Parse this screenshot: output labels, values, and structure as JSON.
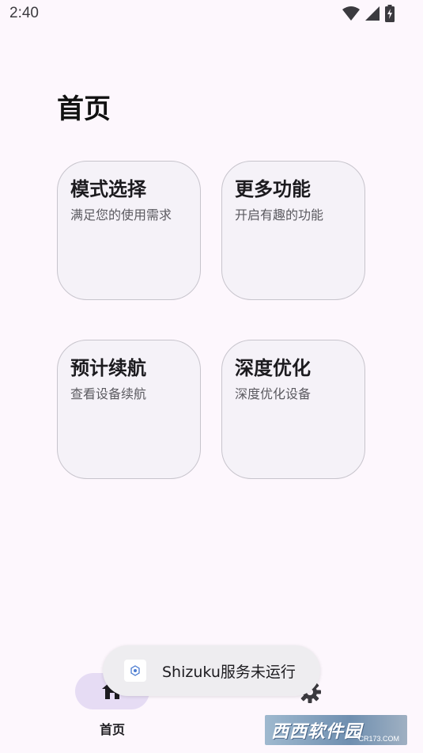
{
  "status_bar": {
    "time": "2:40",
    "icons": [
      "wifi-icon",
      "signal-icon",
      "battery-charging-icon"
    ]
  },
  "page": {
    "title": "首页"
  },
  "cards": [
    {
      "title": "模式选择",
      "subtitle": "满足您的使用需求"
    },
    {
      "title": "更多功能",
      "subtitle": "开启有趣的功能"
    },
    {
      "title": "预计续航",
      "subtitle": "查看设备续航"
    },
    {
      "title": "深度优化",
      "subtitle": "深度优化设备"
    }
  ],
  "bottom_nav": {
    "home_label": "首页",
    "home_icon": "home-icon",
    "settings_icon": "gear-icon"
  },
  "toast": {
    "text": "Shizuku服务未运行",
    "icon": "app-icon"
  },
  "watermark": {
    "text": "西西软件园",
    "sub": "CR173.COM"
  },
  "colors": {
    "background": "#fdf7fd",
    "card_bg": "#f5f2f8",
    "card_border": "#c7c4cc",
    "nav_active_pill": "#e6dcf4",
    "toast_bg": "#eeedf0"
  }
}
